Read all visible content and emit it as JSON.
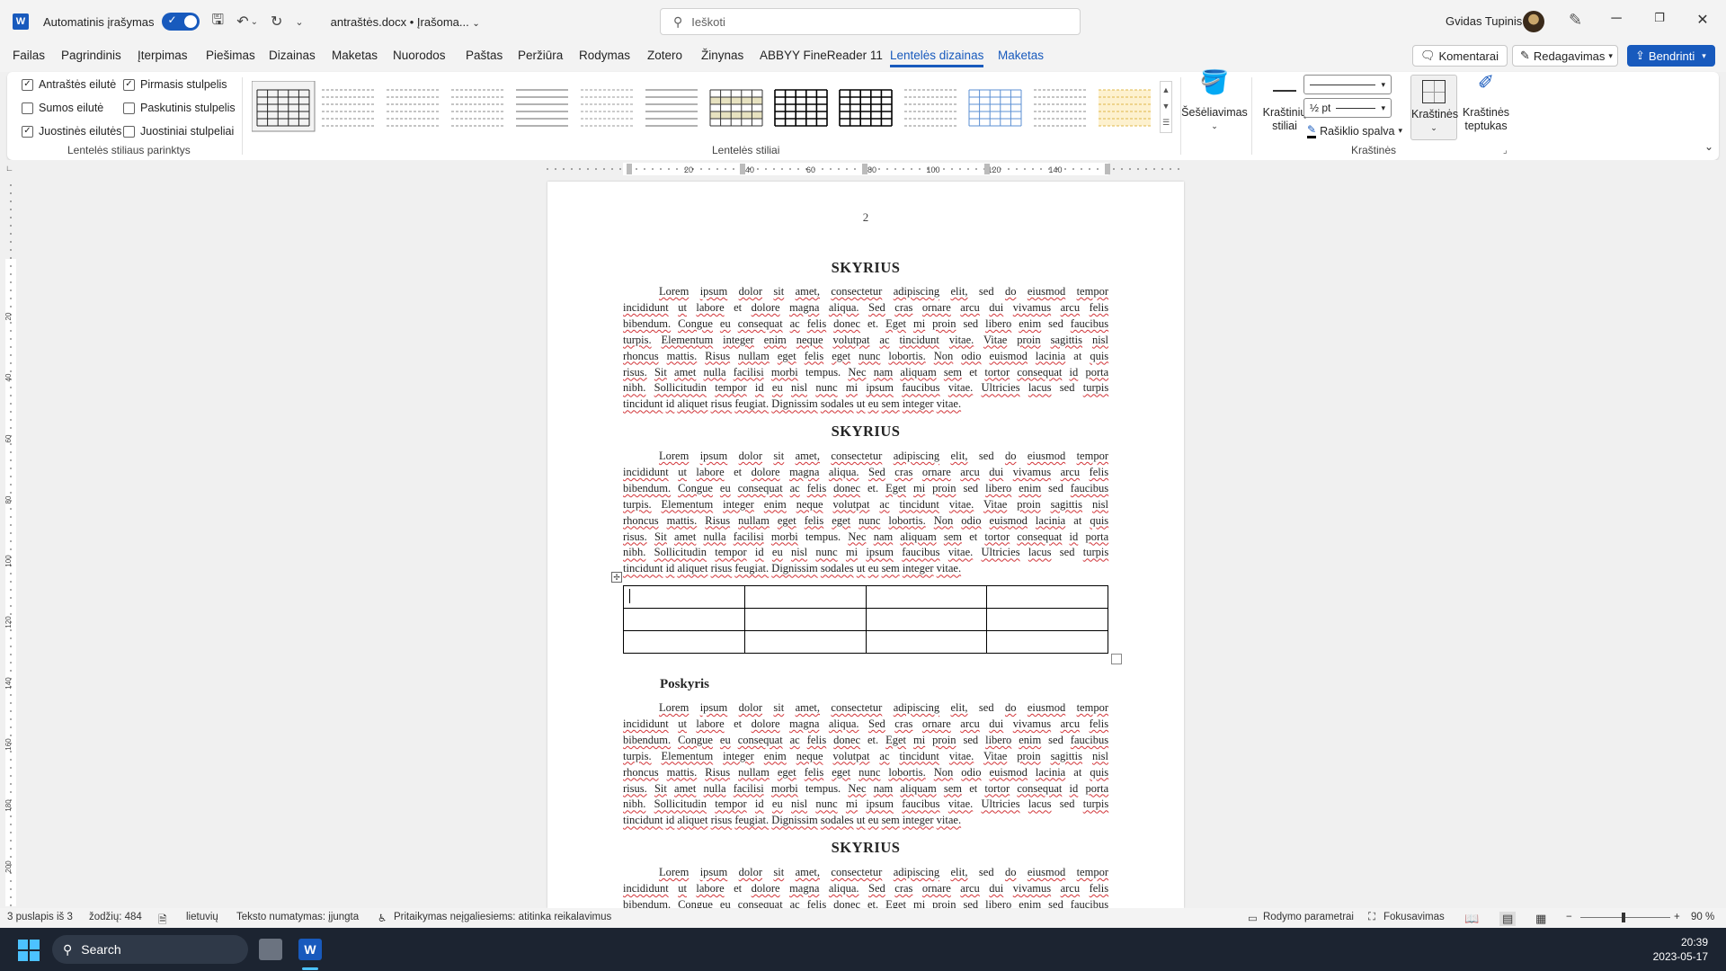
{
  "titlebar": {
    "app_icon": "W",
    "autosave_label": "Automatinis įrašymas",
    "doc_title": "antraštės.docx • Įrašoma...",
    "search_placeholder": "Ieškoti",
    "user_name": "Gvidas Tupinis"
  },
  "tabs": [
    "Failas",
    "Pagrindinis",
    "Įterpimas",
    "Piešimas",
    "Dizainas",
    "Maketas",
    "Nuorodos",
    "Paštas",
    "Peržiūra",
    "Rodymas",
    "Zotero",
    "Žinynas",
    "ABBYY FineReader 11",
    "Lentelės dizainas",
    "Maketas"
  ],
  "active_tab": "Lentelės dizainas",
  "top_buttons": {
    "comments": "Komentarai",
    "editing": "Redagavimas",
    "share": "Bendrinti"
  },
  "ribbon": {
    "options": [
      {
        "label": "Antraštės eilutė",
        "checked": true
      },
      {
        "label": "Sumos eilutė",
        "checked": false
      },
      {
        "label": "Juostinės eilutės",
        "checked": true
      },
      {
        "label": "Pirmasis stulpelis",
        "checked": true
      },
      {
        "label": "Paskutinis stulpelis",
        "checked": false
      },
      {
        "label": "Juostiniai stulpeliai",
        "checked": false
      }
    ],
    "options_group": "Lentelės stiliaus parinktys",
    "styles_group": "Lentelės stiliai",
    "shading": "Šešėliavimas",
    "border_styles": "Kraštinių stiliai",
    "pen_weight": "½ pt",
    "pen_color": "Rašiklio spalva",
    "borders": "Kraštinės",
    "border_painter": "Kraštinės teptukas",
    "borders_group": "Kraštinės"
  },
  "ruler": {
    "h_labels": [
      "20",
      "40",
      "60",
      "80",
      "100",
      "120",
      "140"
    ],
    "v_labels": [
      "20",
      "40",
      "60",
      "80",
      "100",
      "120",
      "140",
      "160",
      "180",
      "200"
    ]
  },
  "document": {
    "page_number": "2",
    "heading": "SKYRIUS",
    "subheading": "Poskyris",
    "paragraph": [
      "Lorem ipsum dolor sit amet, consectetur adipiscing elit, sed do eiusmod tempor",
      "incididunt ut labore et dolore magna aliqua. Sed cras ornare arcu dui vivamus arcu felis",
      "bibendum. Congue eu consequat ac felis donec et. Eget mi proin sed libero enim sed faucibus",
      "turpis. Elementum integer enim neque volutpat ac tincidunt vitae. Vitae proin sagittis nisl",
      "rhoncus mattis. Risus nullam eget felis eget nunc lobortis. Non odio euismod lacinia at quis",
      "risus. Sit amet nulla facilisi morbi tempus. Nec nam aliquam sem et tortor consequat id porta",
      "nibh. Sollicitudin tempor id eu nisl nunc mi ipsum faucibus vitae. Ultricies lacus sed turpis",
      "tincidunt id aliquet risus feugiat. Dignissim sodales ut eu sem integer vitae."
    ],
    "table": {
      "rows": 3,
      "cols": 4
    }
  },
  "status": {
    "page": "3 puslapis iš 3",
    "words": "žodžių: 484",
    "language": "lietuvių",
    "text_prediction": "Teksto numatymas: įjungta",
    "accessibility": "Pritaikymas neįgaliesiems: atitinka reikalavimus",
    "display_settings": "Rodymo parametrai",
    "focus": "Fokusavimas",
    "zoom": "90 %"
  },
  "taskbar": {
    "search": "Search",
    "time": "20:39",
    "date": "2023-05-17"
  }
}
